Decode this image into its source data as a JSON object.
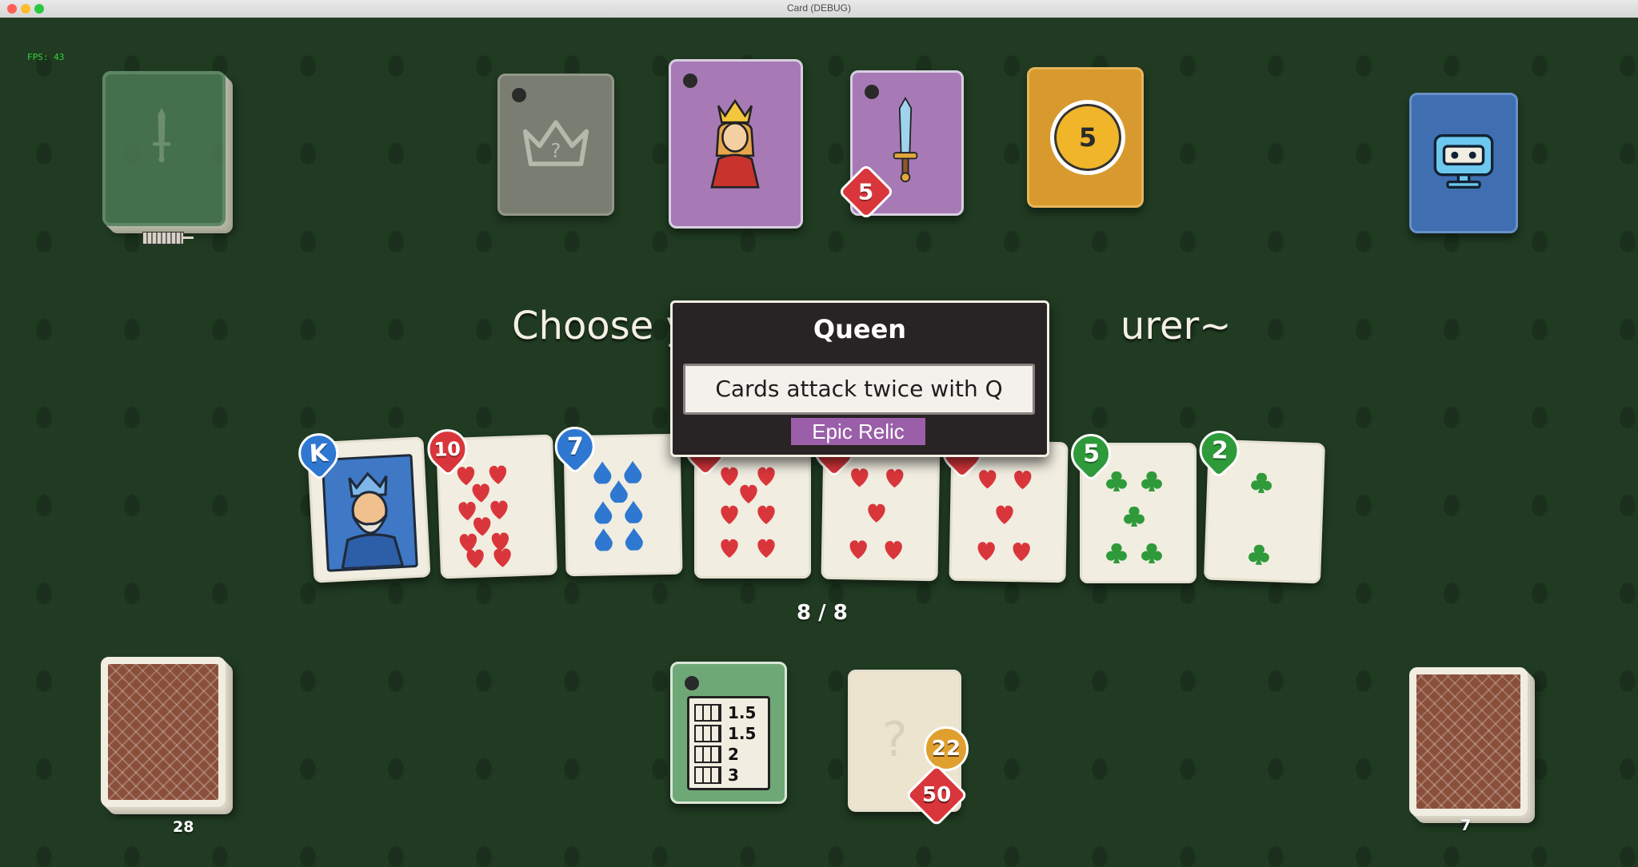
{
  "window": {
    "title": "Card (DEBUG)"
  },
  "hud": {
    "fps": "FPS: 43"
  },
  "prompt": {
    "text": "Choose y",
    "text_tail": "urer~"
  },
  "tooltip": {
    "title": "Queen",
    "description": "Cards attack twice with Q",
    "rarity": "Epic Relic"
  },
  "top_row": {
    "dagger_card_value": "5",
    "coin_card_value": "5"
  },
  "hand": {
    "counter": "8 / 8",
    "cards": [
      {
        "rank": "K",
        "suit": "diamond",
        "color": "blue"
      },
      {
        "rank": "10",
        "suit": "heart",
        "color": "red"
      },
      {
        "rank": "7",
        "suit": "diamond",
        "color": "blue"
      },
      {
        "rank": "",
        "suit": "heart",
        "color": "red"
      },
      {
        "rank": "",
        "suit": "heart",
        "color": "red"
      },
      {
        "rank": "",
        "suit": "heart",
        "color": "red"
      },
      {
        "rank": "5",
        "suit": "club",
        "color": "green"
      },
      {
        "rank": "2",
        "suit": "club",
        "color": "green"
      }
    ]
  },
  "bottom": {
    "draw_pile_count": "28",
    "discard_pile_count": "7",
    "multiplier_rows": [
      "1.5",
      "1.5",
      "2",
      "3"
    ],
    "mystery_card_value_top": "22",
    "mystery_card_value_bottom": "50"
  },
  "colors": {
    "felt": "#203b22",
    "heart": "#d9363b",
    "diamond": "#2f78d1",
    "club": "#2f9a3a",
    "rarity_epic": "#9a5fa8"
  }
}
